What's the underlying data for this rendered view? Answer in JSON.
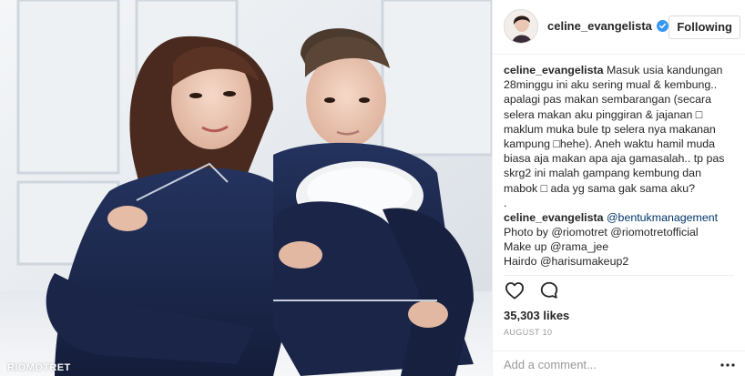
{
  "post": {
    "photo": {
      "watermark": "RIOMOTRET"
    },
    "header": {
      "username": "celine_evangelista",
      "verified_icon": "verified-badge-icon",
      "follow_label": "Following"
    },
    "comments": [
      {
        "user": "celine_evangelista",
        "text": "Masuk usia kandungan 28minggu ini aku sering mual & kembung.. apalagi pas makan sembarangan (secara selera makan aku pinggiran & jajanan □ maklum muka bule tp selera nya makanan kampung □hehe). Aneh waktu hamil muda biasa aja makan apa aja gamasalah.. tp pas skrg2 ini malah gampang kembung dan mabok □ ada yg sama gak sama aku?"
      },
      {
        "user": "",
        "text": "."
      },
      {
        "user": "celine_evangelista",
        "text": "@bentukmanagement"
      },
      {
        "user": "",
        "text": "Photo by @riomotret @riomotretofficial"
      },
      {
        "user": "",
        "text": "Make up @rama_jee"
      },
      {
        "user": "",
        "text": "Hairdo @harisumakeup2"
      }
    ],
    "actions": {
      "like_icon": "heart-icon",
      "comment_icon": "comment-icon"
    },
    "likes": "35,303 likes",
    "date": "AUGUST 10",
    "add_comment_placeholder": "Add a comment...",
    "more_icon": "more-options-icon",
    "colors": {
      "verified": "#3897f0",
      "text": "#262626",
      "muted": "#999999",
      "border": "#efefef",
      "mention": "#003569",
      "pajama": "#1c2a4f"
    }
  }
}
